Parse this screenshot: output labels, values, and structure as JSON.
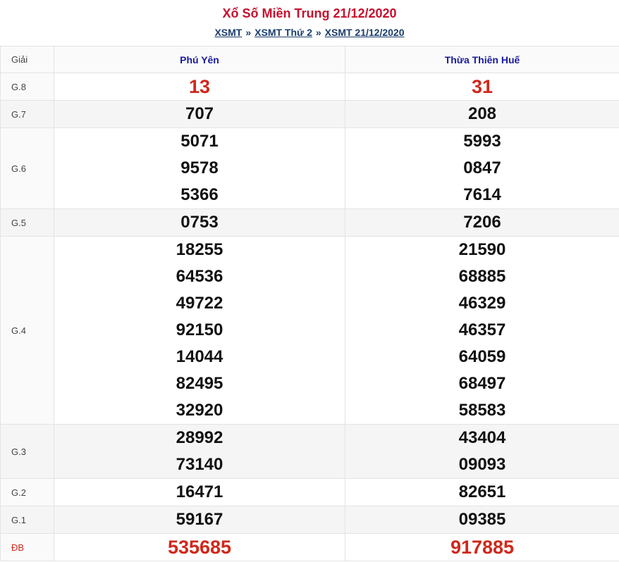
{
  "header": {
    "title": "Xổ Số Miền Trung 21/12/2020",
    "breadcrumbs": [
      "XSMT",
      "XSMT Thứ 2",
      "XSMT 21/12/2020"
    ],
    "separator": "»"
  },
  "table": {
    "col_prize": "Giải",
    "col_1": "Phú Yên",
    "col_2": "Thừa Thiên Huế",
    "rows": [
      {
        "label": "G.8",
        "c1": [
          "13"
        ],
        "c2": [
          "31"
        ]
      },
      {
        "label": "G.7",
        "c1": [
          "707"
        ],
        "c2": [
          "208"
        ]
      },
      {
        "label": "G.6",
        "c1": [
          "5071",
          "9578",
          "5366"
        ],
        "c2": [
          "5993",
          "0847",
          "7614"
        ]
      },
      {
        "label": "G.5",
        "c1": [
          "0753"
        ],
        "c2": [
          "7206"
        ]
      },
      {
        "label": "G.4",
        "c1": [
          "18255",
          "64536",
          "49722",
          "92150",
          "14044",
          "82495",
          "32920"
        ],
        "c2": [
          "21590",
          "68885",
          "46329",
          "46357",
          "64059",
          "68497",
          "58583"
        ]
      },
      {
        "label": "G.3",
        "c1": [
          "28992",
          "73140"
        ],
        "c2": [
          "43404",
          "09093"
        ]
      },
      {
        "label": "G.2",
        "c1": [
          "16471"
        ],
        "c2": [
          "82651"
        ]
      },
      {
        "label": "G.1",
        "c1": [
          "59167"
        ],
        "c2": [
          "09385"
        ]
      },
      {
        "label": "ĐB",
        "c1": [
          "535685"
        ],
        "c2": [
          "917885"
        ]
      }
    ]
  }
}
